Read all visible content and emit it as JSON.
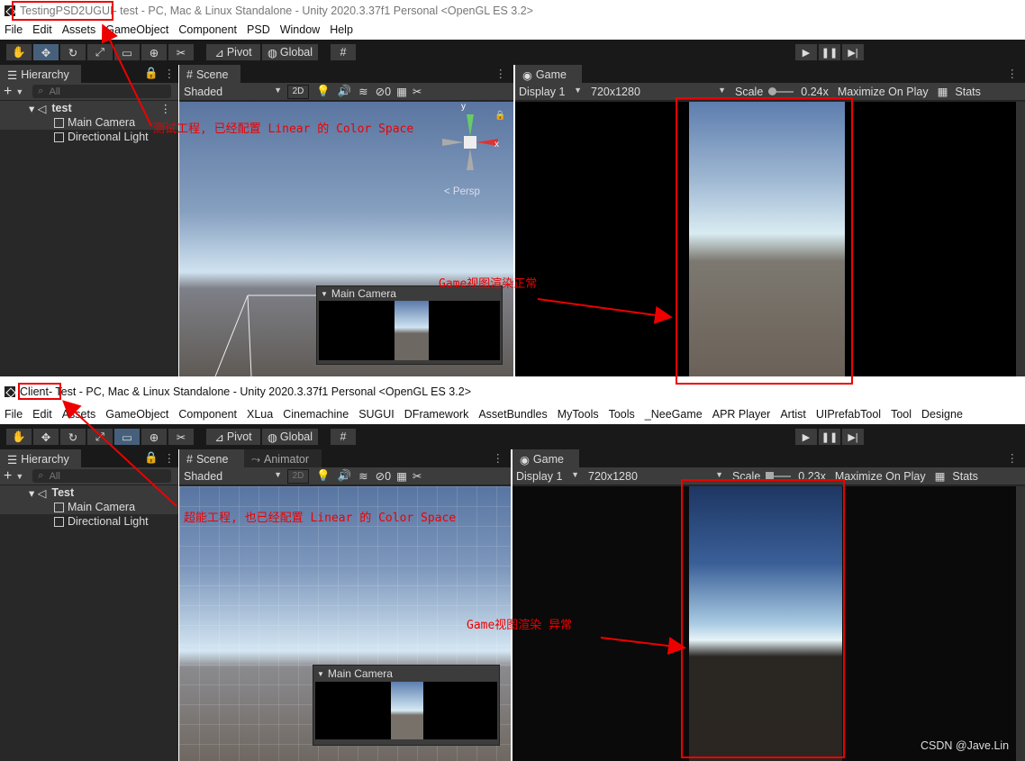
{
  "top": {
    "title_project": "TestingPSD2UGUI",
    "title_rest": " - test - PC, Mac & Linux Standalone - Unity 2020.3.37f1 Personal <OpenGL ES 3.2>",
    "menu": [
      "File",
      "Edit",
      "Assets",
      "GameObject",
      "Component",
      "PSD",
      "Window",
      "Help"
    ],
    "toolbar": {
      "pivot": "Pivot",
      "global": "Global"
    },
    "hierarchy": {
      "tab": "Hierarchy",
      "search_placeholder": "All",
      "scene": "test",
      "items": [
        "Main Camera",
        "Directional Light"
      ]
    },
    "scene": {
      "tab": "Scene",
      "shading": "Shaded",
      "mode2d": "2D",
      "gizmo_count": "0",
      "persp": "< Persp",
      "axis_y": "y",
      "axis_x": "x",
      "cam_preview_title": "Main Camera"
    },
    "game": {
      "tab": "Game",
      "display": "Display 1",
      "resolution": "720x1280",
      "scale_label": "Scale",
      "scale_value": "0.24x",
      "maximize": "Maximize On Play",
      "stats": "Stats"
    }
  },
  "bottom": {
    "title_project": "Client",
    "title_rest": " - Test - PC, Mac & Linux Standalone - Unity 2020.3.37f1 Personal <OpenGL ES 3.2>",
    "menu": [
      "File",
      "Edit",
      "Assets",
      "GameObject",
      "Component",
      "XLua",
      "Cinemachine",
      "SUGUI",
      "DFramework",
      "AssetBundles",
      "MyTools",
      "Tools",
      "_NeeGame",
      "APR Player",
      "Artist",
      "UIPrefabTool",
      "Tool",
      "Designe"
    ],
    "toolbar": {
      "pivot": "Pivot",
      "global": "Global"
    },
    "hierarchy": {
      "tab": "Hierarchy",
      "search_placeholder": "All",
      "scene": "Test",
      "items": [
        "Main Camera",
        "Directional Light"
      ]
    },
    "scene": {
      "tab": "Scene",
      "tab2": "Animator",
      "shading": "Shaded",
      "mode2d": "2D",
      "gizmo_count": "0",
      "cam_preview_title": "Main Camera"
    },
    "game": {
      "tab": "Game",
      "display": "Display 1",
      "resolution": "720x1280",
      "scale_label": "Scale",
      "scale_value": "0.23x",
      "maximize": "Maximize On Play",
      "stats": "Stats"
    }
  },
  "annotations": {
    "top_project": "测试工程, 已经配置 Linear 的 Color Space",
    "top_game": "Game视图渲染正常",
    "bottom_project": "超能工程, 也已经配置 Linear 的 Color Space",
    "bottom_game": "Game视图渲染 异常"
  },
  "watermark": "CSDN @Jave.Lin",
  "colors": {
    "annotation": "#e00000",
    "editor_bg": "#282828",
    "toolbar_bg": "#191919"
  }
}
